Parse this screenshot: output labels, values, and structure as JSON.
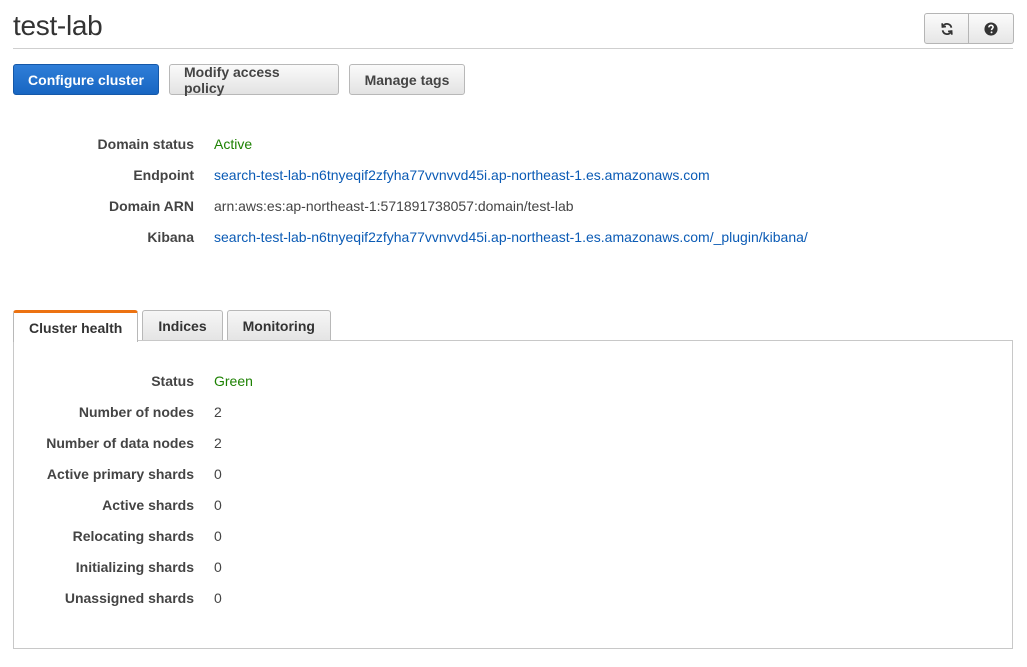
{
  "header": {
    "title": "test-lab"
  },
  "toolbar": {
    "refresh_icon": "refresh-icon",
    "help_icon": "help-icon",
    "configure_label": "Configure cluster",
    "modify_label": "Modify access policy",
    "tags_label": "Manage tags"
  },
  "overview": {
    "rows": [
      {
        "label": "Domain status",
        "value": "Active",
        "style": "green"
      },
      {
        "label": "Endpoint",
        "value": "search-test-lab-n6tnyeqif2zfyha77vvnvvd45i.ap-northeast-1.es.amazonaws.com",
        "style": "link"
      },
      {
        "label": "Domain ARN",
        "value": "arn:aws:es:ap-northeast-1:571891738057:domain/test-lab",
        "style": "plain"
      },
      {
        "label": "Kibana",
        "value": "search-test-lab-n6tnyeqif2zfyha77vvnvvd45i.ap-northeast-1.es.amazonaws.com/_plugin/kibana/",
        "style": "link"
      }
    ]
  },
  "tabs": [
    {
      "label": "Cluster health",
      "active": true
    },
    {
      "label": "Indices",
      "active": false
    },
    {
      "label": "Monitoring",
      "active": false
    }
  ],
  "health": {
    "rows": [
      {
        "label": "Status",
        "value": "Green",
        "style": "green"
      },
      {
        "label": "Number of nodes",
        "value": "2",
        "style": "plain"
      },
      {
        "label": "Number of data nodes",
        "value": "2",
        "style": "plain"
      },
      {
        "label": "Active primary shards",
        "value": "0",
        "style": "plain"
      },
      {
        "label": "Active shards",
        "value": "0",
        "style": "plain"
      },
      {
        "label": "Relocating shards",
        "value": "0",
        "style": "plain"
      },
      {
        "label": "Initializing shards",
        "value": "0",
        "style": "plain"
      },
      {
        "label": "Unassigned shards",
        "value": "0",
        "style": "plain"
      }
    ]
  },
  "colors": {
    "primary": "#1866c2",
    "link": "#0b5bb5",
    "success": "#1d8102",
    "tab_accent": "#ec7211"
  }
}
